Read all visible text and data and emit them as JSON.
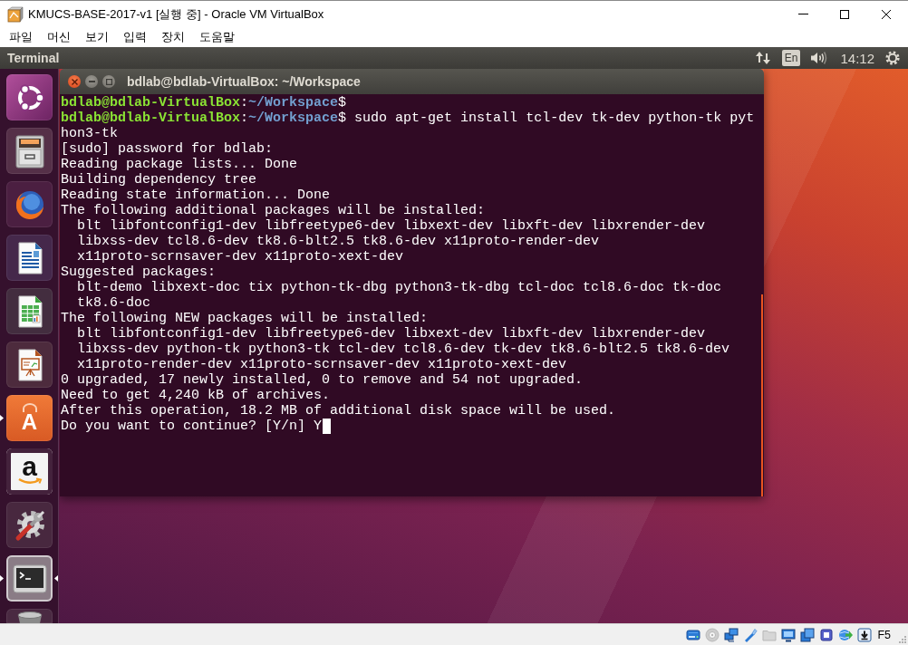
{
  "window": {
    "title": "KMUCS-BASE-2017-v1 [실행 중] - Oracle VM VirtualBox"
  },
  "menu_bar": [
    "파일",
    "머신",
    "보기",
    "입력",
    "장치",
    "도움말"
  ],
  "top_panel": {
    "app_name": "Terminal",
    "keyboard_layout": "En",
    "clock": "14:12"
  },
  "launcher": [
    {
      "kind": "dash",
      "running": false,
      "focused": false
    },
    {
      "kind": "files",
      "running": false,
      "focused": false
    },
    {
      "kind": "browser",
      "running": false,
      "focused": false
    },
    {
      "kind": "writer",
      "running": false,
      "focused": false
    },
    {
      "kind": "calc",
      "running": false,
      "focused": false
    },
    {
      "kind": "impress",
      "running": false,
      "focused": false
    },
    {
      "kind": "store",
      "glyph": "A",
      "running": true,
      "focused": false
    },
    {
      "kind": "shop",
      "glyph": "a",
      "running": false,
      "focused": false
    },
    {
      "kind": "settings",
      "running": false,
      "focused": false
    },
    {
      "kind": "terminal",
      "running": true,
      "focused": true
    },
    {
      "kind": "trash",
      "running": false,
      "focused": false
    }
  ],
  "terminal": {
    "title": "bdlab@bdlab-VirtualBox: ~/Workspace",
    "cursor": true,
    "lines": [
      {
        "kind": "prompt",
        "segments": [
          {
            "kind": "user",
            "text": "bdlab@bdlab-VirtualBox"
          },
          {
            "kind": "plain",
            "text": ":"
          },
          {
            "kind": "path",
            "text": "~/Workspace"
          },
          {
            "kind": "plain",
            "text": "$"
          }
        ]
      },
      {
        "kind": "prompt",
        "segments": [
          {
            "kind": "user",
            "text": "bdlab@bdlab-VirtualBox"
          },
          {
            "kind": "plain",
            "text": ":"
          },
          {
            "kind": "path",
            "text": "~/Workspace"
          },
          {
            "kind": "plain",
            "text": "$ sudo apt-get install tcl-dev tk-dev python-tk pyt"
          }
        ]
      },
      {
        "kind": "output",
        "text": "hon3-tk"
      },
      {
        "kind": "output",
        "text": "[sudo] password for bdlab:"
      },
      {
        "kind": "output",
        "text": "Reading package lists... Done"
      },
      {
        "kind": "output",
        "text": "Building dependency tree"
      },
      {
        "kind": "output",
        "text": "Reading state information... Done"
      },
      {
        "kind": "output",
        "text": "The following additional packages will be installed:",
        "children": [
          {
            "kind": "output",
            "text": "blt libfontconfig1-dev libfreetype6-dev libxext-dev libxft-dev libxrender-dev"
          },
          {
            "kind": "output",
            "text": "libxss-dev tcl8.6-dev tk8.6-blt2.5 tk8.6-dev x11proto-render-dev"
          },
          {
            "kind": "output",
            "text": "x11proto-scrnsaver-dev x11proto-xext-dev"
          }
        ]
      },
      {
        "kind": "output",
        "text": "Suggested packages:",
        "children": [
          {
            "kind": "output",
            "text": "blt-demo libxext-doc tix python-tk-dbg python3-tk-dbg tcl-doc tcl8.6-doc tk-doc"
          },
          {
            "kind": "output",
            "text": "tk8.6-doc"
          }
        ]
      },
      {
        "kind": "output",
        "text": "The following NEW packages will be installed:",
        "children": [
          {
            "kind": "output",
            "text": "blt libfontconfig1-dev libfreetype6-dev libxext-dev libxft-dev libxrender-dev"
          },
          {
            "kind": "output",
            "text": "libxss-dev python-tk python3-tk tcl-dev tcl8.6-dev tk-dev tk8.6-blt2.5 tk8.6-dev"
          },
          {
            "kind": "output",
            "text": "x11proto-render-dev x11proto-scrnsaver-dev x11proto-xext-dev"
          }
        ]
      },
      {
        "kind": "output",
        "text": "0 upgraded, 17 newly installed, 0 to remove and 54 not upgraded."
      },
      {
        "kind": "output",
        "text": "Need to get 4,240 kB of archives."
      },
      {
        "kind": "output",
        "text": "After this operation, 18.2 MB of additional disk space will be used."
      },
      {
        "kind": "output",
        "text": "Do you want to continue? [Y/n] Y"
      }
    ]
  },
  "status_bar": {
    "indicators": [
      {
        "kind": "disk",
        "active": true
      },
      {
        "kind": "optical",
        "active": false
      },
      {
        "kind": "network",
        "active": true
      },
      {
        "kind": "usb",
        "active": true
      },
      {
        "kind": "folder",
        "active": false
      },
      {
        "kind": "display",
        "active": true
      },
      {
        "kind": "capture",
        "active": true
      },
      {
        "kind": "cpu",
        "active": true
      },
      {
        "kind": "mouse",
        "active": true
      },
      {
        "kind": "keyboard",
        "active": true
      }
    ],
    "host_key": "F5"
  }
}
